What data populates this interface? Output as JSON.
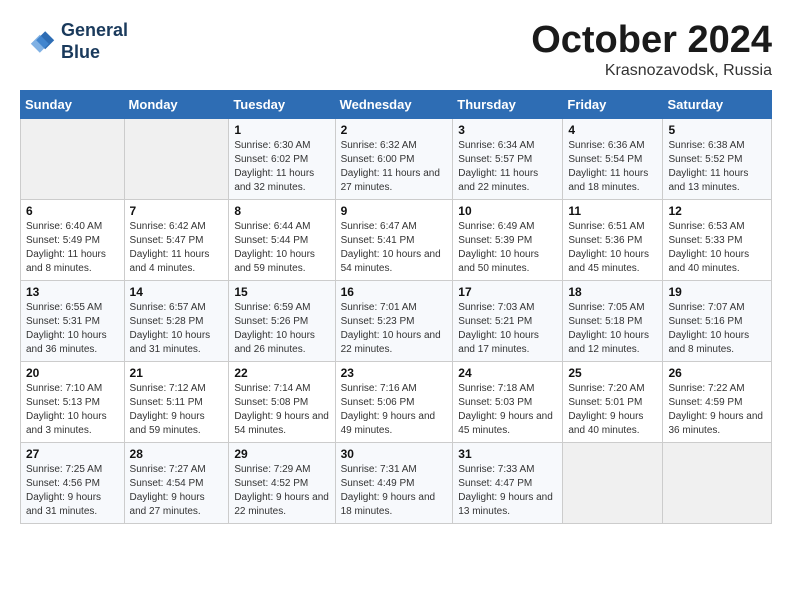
{
  "header": {
    "logo_line1": "General",
    "logo_line2": "Blue",
    "month": "October 2024",
    "location": "Krasnozavodsk, Russia"
  },
  "weekdays": [
    "Sunday",
    "Monday",
    "Tuesday",
    "Wednesday",
    "Thursday",
    "Friday",
    "Saturday"
  ],
  "weeks": [
    [
      {
        "day": "",
        "info": ""
      },
      {
        "day": "",
        "info": ""
      },
      {
        "day": "1",
        "info": "Sunrise: 6:30 AM\nSunset: 6:02 PM\nDaylight: 11 hours and 32 minutes."
      },
      {
        "day": "2",
        "info": "Sunrise: 6:32 AM\nSunset: 6:00 PM\nDaylight: 11 hours and 27 minutes."
      },
      {
        "day": "3",
        "info": "Sunrise: 6:34 AM\nSunset: 5:57 PM\nDaylight: 11 hours and 22 minutes."
      },
      {
        "day": "4",
        "info": "Sunrise: 6:36 AM\nSunset: 5:54 PM\nDaylight: 11 hours and 18 minutes."
      },
      {
        "day": "5",
        "info": "Sunrise: 6:38 AM\nSunset: 5:52 PM\nDaylight: 11 hours and 13 minutes."
      }
    ],
    [
      {
        "day": "6",
        "info": "Sunrise: 6:40 AM\nSunset: 5:49 PM\nDaylight: 11 hours and 8 minutes."
      },
      {
        "day": "7",
        "info": "Sunrise: 6:42 AM\nSunset: 5:47 PM\nDaylight: 11 hours and 4 minutes."
      },
      {
        "day": "8",
        "info": "Sunrise: 6:44 AM\nSunset: 5:44 PM\nDaylight: 10 hours and 59 minutes."
      },
      {
        "day": "9",
        "info": "Sunrise: 6:47 AM\nSunset: 5:41 PM\nDaylight: 10 hours and 54 minutes."
      },
      {
        "day": "10",
        "info": "Sunrise: 6:49 AM\nSunset: 5:39 PM\nDaylight: 10 hours and 50 minutes."
      },
      {
        "day": "11",
        "info": "Sunrise: 6:51 AM\nSunset: 5:36 PM\nDaylight: 10 hours and 45 minutes."
      },
      {
        "day": "12",
        "info": "Sunrise: 6:53 AM\nSunset: 5:33 PM\nDaylight: 10 hours and 40 minutes."
      }
    ],
    [
      {
        "day": "13",
        "info": "Sunrise: 6:55 AM\nSunset: 5:31 PM\nDaylight: 10 hours and 36 minutes."
      },
      {
        "day": "14",
        "info": "Sunrise: 6:57 AM\nSunset: 5:28 PM\nDaylight: 10 hours and 31 minutes."
      },
      {
        "day": "15",
        "info": "Sunrise: 6:59 AM\nSunset: 5:26 PM\nDaylight: 10 hours and 26 minutes."
      },
      {
        "day": "16",
        "info": "Sunrise: 7:01 AM\nSunset: 5:23 PM\nDaylight: 10 hours and 22 minutes."
      },
      {
        "day": "17",
        "info": "Sunrise: 7:03 AM\nSunset: 5:21 PM\nDaylight: 10 hours and 17 minutes."
      },
      {
        "day": "18",
        "info": "Sunrise: 7:05 AM\nSunset: 5:18 PM\nDaylight: 10 hours and 12 minutes."
      },
      {
        "day": "19",
        "info": "Sunrise: 7:07 AM\nSunset: 5:16 PM\nDaylight: 10 hours and 8 minutes."
      }
    ],
    [
      {
        "day": "20",
        "info": "Sunrise: 7:10 AM\nSunset: 5:13 PM\nDaylight: 10 hours and 3 minutes."
      },
      {
        "day": "21",
        "info": "Sunrise: 7:12 AM\nSunset: 5:11 PM\nDaylight: 9 hours and 59 minutes."
      },
      {
        "day": "22",
        "info": "Sunrise: 7:14 AM\nSunset: 5:08 PM\nDaylight: 9 hours and 54 minutes."
      },
      {
        "day": "23",
        "info": "Sunrise: 7:16 AM\nSunset: 5:06 PM\nDaylight: 9 hours and 49 minutes."
      },
      {
        "day": "24",
        "info": "Sunrise: 7:18 AM\nSunset: 5:03 PM\nDaylight: 9 hours and 45 minutes."
      },
      {
        "day": "25",
        "info": "Sunrise: 7:20 AM\nSunset: 5:01 PM\nDaylight: 9 hours and 40 minutes."
      },
      {
        "day": "26",
        "info": "Sunrise: 7:22 AM\nSunset: 4:59 PM\nDaylight: 9 hours and 36 minutes."
      }
    ],
    [
      {
        "day": "27",
        "info": "Sunrise: 7:25 AM\nSunset: 4:56 PM\nDaylight: 9 hours and 31 minutes."
      },
      {
        "day": "28",
        "info": "Sunrise: 7:27 AM\nSunset: 4:54 PM\nDaylight: 9 hours and 27 minutes."
      },
      {
        "day": "29",
        "info": "Sunrise: 7:29 AM\nSunset: 4:52 PM\nDaylight: 9 hours and 22 minutes."
      },
      {
        "day": "30",
        "info": "Sunrise: 7:31 AM\nSunset: 4:49 PM\nDaylight: 9 hours and 18 minutes."
      },
      {
        "day": "31",
        "info": "Sunrise: 7:33 AM\nSunset: 4:47 PM\nDaylight: 9 hours and 13 minutes."
      },
      {
        "day": "",
        "info": ""
      },
      {
        "day": "",
        "info": ""
      }
    ]
  ]
}
